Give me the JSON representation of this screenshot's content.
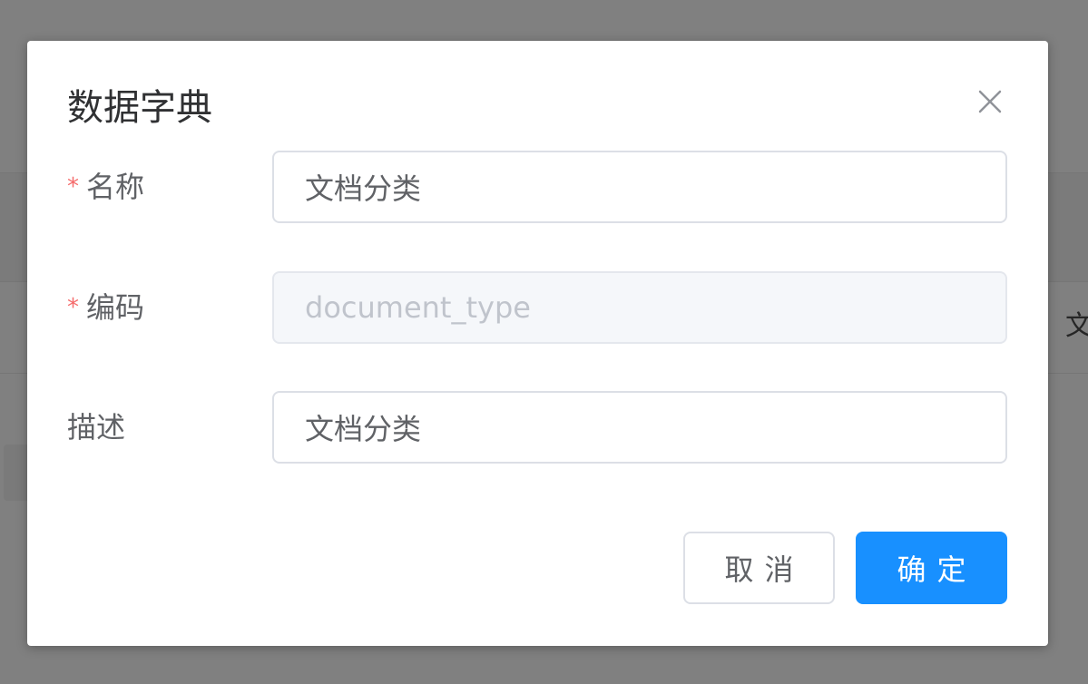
{
  "background": {
    "peek_text": "文"
  },
  "dialog": {
    "title": "数据字典",
    "close_icon": "close-icon",
    "fields": {
      "name": {
        "label": "名称",
        "required_mark": "*",
        "value": "文档分类"
      },
      "code": {
        "label": "编码",
        "required_mark": "*",
        "value": "document_type",
        "disabled": true
      },
      "description": {
        "label": "描述",
        "value": "文档分类"
      }
    },
    "buttons": {
      "cancel_label": "取消",
      "confirm_label": "确定"
    }
  },
  "colors": {
    "overlay": "#808080",
    "primary": "#1890ff",
    "required": "#f56c6c",
    "label_text": "#606266",
    "title_text": "#303133",
    "border": "#dcdfe6",
    "disabled_bg": "#f5f7fa",
    "disabled_text": "#c0c4cc"
  }
}
